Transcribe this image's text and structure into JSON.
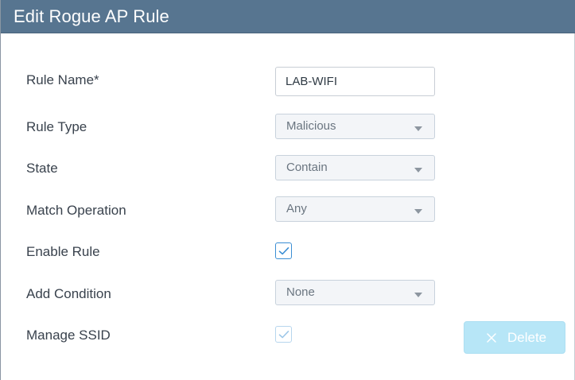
{
  "dialog": {
    "title": "Edit Rogue AP Rule"
  },
  "form": {
    "rule_name": {
      "label": "Rule Name*",
      "value": "LAB-WIFI"
    },
    "rule_type": {
      "label": "Rule Type",
      "value": "Malicious"
    },
    "state": {
      "label": "State",
      "value": "Contain"
    },
    "match_operation": {
      "label": "Match Operation",
      "value": "Any"
    },
    "enable_rule": {
      "label": "Enable Rule",
      "checked": true
    },
    "add_condition": {
      "label": "Add Condition",
      "value": "None"
    },
    "manage_ssid": {
      "label": "Manage SSID",
      "checked": true,
      "disabled": true
    }
  },
  "actions": {
    "delete_label": "Delete",
    "delete_icon": "close-icon",
    "delete_disabled": true
  },
  "colors": {
    "titlebar": "#577590",
    "checkbox_active": "#3b8ed4",
    "delete_button": "#b7e6f7"
  }
}
